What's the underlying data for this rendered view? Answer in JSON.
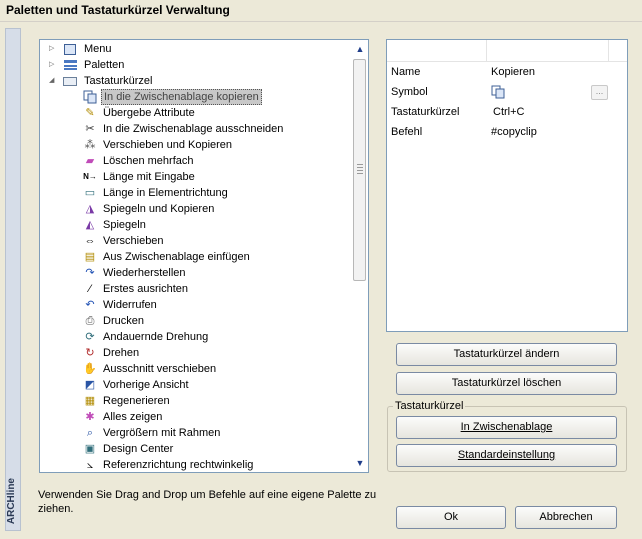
{
  "window": {
    "title": "Paletten und Tastaturkürzel Verwaltung"
  },
  "sidebar": {
    "brand": "ARCHline"
  },
  "tree": {
    "items": [
      {
        "label": "Menu",
        "icon": "menu-tree-icon",
        "level": 0,
        "expander": "collapsed"
      },
      {
        "label": "Paletten",
        "icon": "palette-list-icon",
        "level": 0,
        "expander": "collapsed"
      },
      {
        "label": "Tastaturkürzel",
        "icon": "keyboard-icon",
        "level": 0,
        "expander": "expanded"
      },
      {
        "label": "In die Zwischenablage kopieren",
        "icon": "copy-icon",
        "level": 1,
        "selected": true
      },
      {
        "label": "Übergebe Attribute",
        "icon": "transfer-attributes-icon",
        "level": 1
      },
      {
        "label": "In die Zwischenablage ausschneiden",
        "icon": "cut-icon",
        "level": 1
      },
      {
        "label": "Verschieben und Kopieren",
        "icon": "move-copy-icon",
        "level": 1
      },
      {
        "label": "Löschen mehrfach",
        "icon": "eraser-icon",
        "level": 1
      },
      {
        "label": "Länge mit Eingabe",
        "icon": "length-input-icon",
        "level": 1
      },
      {
        "label": "Länge in Elementrichtung",
        "icon": "length-direction-icon",
        "level": 1
      },
      {
        "label": "Spiegeln und Kopieren",
        "icon": "mirror-copy-icon",
        "level": 1
      },
      {
        "label": "Spiegeln",
        "icon": "mirror-icon",
        "level": 1
      },
      {
        "label": "Verschieben",
        "icon": "move-icon",
        "level": 1
      },
      {
        "label": "Aus Zwischenablage einfügen",
        "icon": "paste-icon",
        "level": 1
      },
      {
        "label": "Wiederherstellen",
        "icon": "redo-icon",
        "level": 1
      },
      {
        "label": "Erstes ausrichten",
        "icon": "align-icon",
        "level": 1
      },
      {
        "label": "Widerrufen",
        "icon": "undo-icon",
        "level": 1
      },
      {
        "label": "Drucken",
        "icon": "printer-icon",
        "level": 1
      },
      {
        "label": "Andauernde Drehung",
        "icon": "continuous-rotate-icon",
        "level": 1
      },
      {
        "label": "Drehen",
        "icon": "rotate-icon",
        "level": 1
      },
      {
        "label": "Ausschnitt verschieben",
        "icon": "pan-hand-icon",
        "level": 1
      },
      {
        "label": "Vorherige Ansicht",
        "icon": "previous-view-icon",
        "level": 1
      },
      {
        "label": "Regenerieren",
        "icon": "regenerate-icon",
        "level": 1
      },
      {
        "label": "Alles zeigen",
        "icon": "zoom-all-icon",
        "level": 1
      },
      {
        "label": "Vergrößern mit Rahmen",
        "icon": "zoom-window-icon",
        "level": 1
      },
      {
        "label": "Design Center",
        "icon": "design-center-icon",
        "level": 1
      },
      {
        "label": "Referenzrichtung rechtwinkelig",
        "icon": "reference-direction-icon",
        "level": 1
      }
    ]
  },
  "properties": {
    "rows": [
      {
        "name": "Name",
        "value": "Kopieren"
      },
      {
        "name": "Symbol",
        "value": "",
        "icon": "copy-icon",
        "button": "..."
      },
      {
        "name": "Tastaturkürzel",
        "value": "Ctrl+C"
      },
      {
        "name": "Befehl",
        "value": "#copyclip"
      }
    ]
  },
  "buttons": {
    "change_shortcut": "Tastaturkürzel ändern",
    "delete_shortcut": "Tastaturkürzel löschen",
    "to_clipboard": "In Zwischenablage",
    "default_setting": "Standardeinstellung",
    "ok": "Ok",
    "cancel": "Abbrechen"
  },
  "group": {
    "title": "Tastaturkürzel"
  },
  "hint": "Verwenden Sie Drag and Drop um Befehle auf eine eigene Palette zu ziehen.",
  "colors": {
    "selection": "#c8c8c8",
    "panel_border": "#7f9db9",
    "background": "#ece9d8"
  }
}
